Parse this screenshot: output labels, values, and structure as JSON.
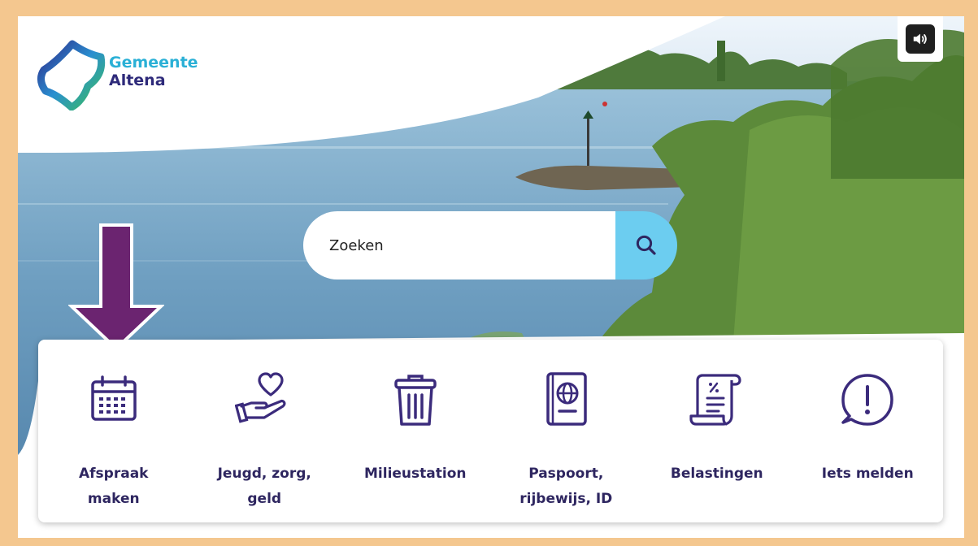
{
  "logo": {
    "line1": "Gemeente",
    "line2": "Altena"
  },
  "search": {
    "placeholder": "Zoeken",
    "value": ""
  },
  "tiles": [
    {
      "label": "Afspraak maken",
      "icon": "calendar-icon"
    },
    {
      "label": "Jeugd, zorg, geld",
      "icon": "hand-heart-icon"
    },
    {
      "label": "Milieustation",
      "icon": "trash-bin-icon"
    },
    {
      "label": "Paspoort, rijbewijs, ID",
      "icon": "passport-icon"
    },
    {
      "label": "Belastingen",
      "icon": "tax-scroll-icon"
    },
    {
      "label": "Iets melden",
      "icon": "alert-chat-icon"
    }
  ],
  "colors": {
    "frame": "#f4c78f",
    "brand_blue": "#2ab0d6",
    "brand_navy": "#2e2a7a",
    "icon_purple": "#3b2b7c",
    "search_button": "#6ccdf0",
    "arrow": "#6b2470"
  }
}
